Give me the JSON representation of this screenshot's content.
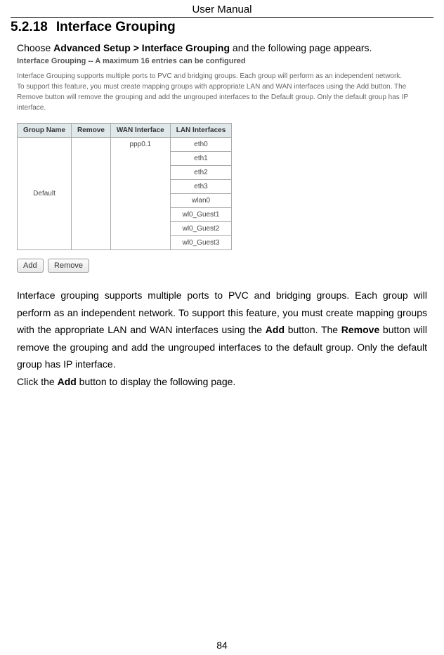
{
  "header": {
    "title": "User Manual"
  },
  "section": {
    "number": "5.2.18",
    "title": "Interface Grouping"
  },
  "intro": {
    "prefix": "Choose ",
    "bold": "Advanced Setup > Interface Grouping",
    "suffix": " and the following page appears."
  },
  "screenshot": {
    "title": "Interface Grouping -- A maximum 16 entries can be configured",
    "desc": "Interface Grouping supports multiple ports to PVC and bridging groups. Each group will perform as an independent network. To support this feature, you must create mapping groups with appropriate LAN and WAN interfaces using the Add button. The Remove button will remove the grouping and add the ungrouped interfaces to the Default group. Only the default group has IP interface.",
    "headers": [
      "Group Name",
      "Remove",
      "WAN Interface",
      "LAN Interfaces"
    ],
    "group_name": "Default",
    "wan_if": "ppp0.1",
    "lan_ifs": [
      "eth0",
      "eth1",
      "eth2",
      "eth3",
      "wlan0",
      "wl0_Guest1",
      "wl0_Guest2",
      "wl0_Guest3"
    ],
    "btn_add": "Add",
    "btn_remove": "Remove"
  },
  "body": {
    "p1a": "Interface grouping supports multiple ports to PVC and bridging groups. Each group will perform as an independent network. To support this feature, you must create mapping groups with the appropriate LAN and WAN interfaces using the ",
    "p1_add": "Add",
    "p1b": " button. The ",
    "p1_remove": "Remove",
    "p1c": " button will remove the grouping and add the ungrouped interfaces to the default group. Only the default group has IP interface.",
    "p2a": "Click the ",
    "p2_add": "Add",
    "p2b": " button to display the following page."
  },
  "page_number": "84"
}
